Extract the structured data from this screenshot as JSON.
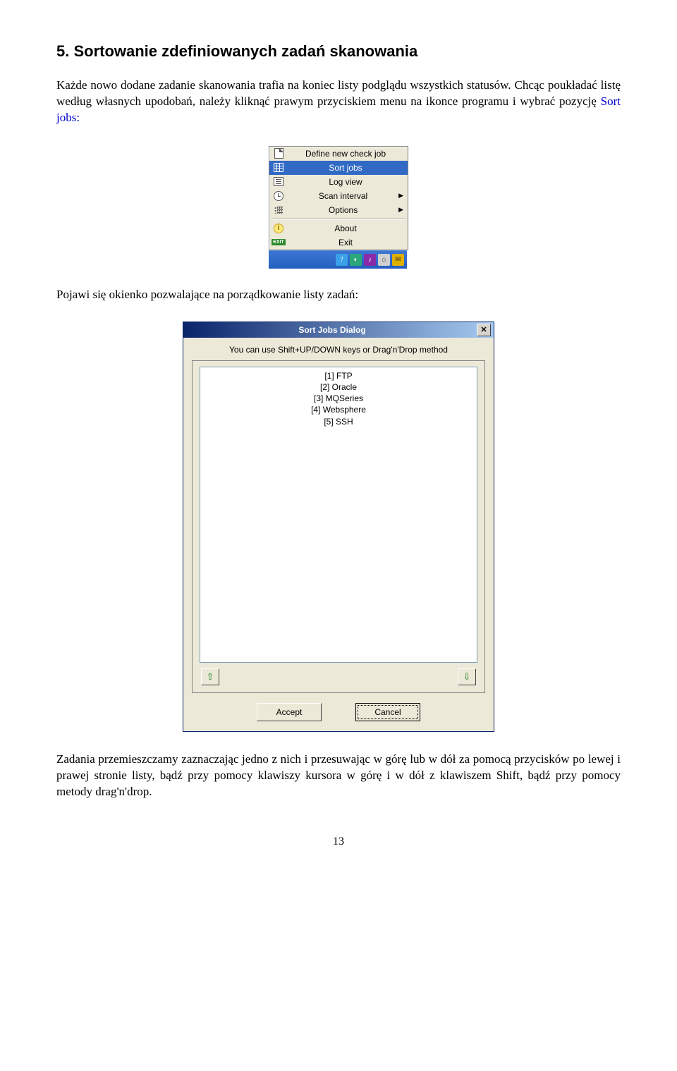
{
  "heading": "5. Sortowanie zdefiniowanych zadań skanowania",
  "para1": "Każde nowo dodane zadanie skanowania trafia na koniec listy podglądu wszystkich statusów. Chcąc poukładać listę według własnych upodobań, należy kliknąć prawym przyciskiem menu na ikonce programu i wybrać pozycję ",
  "para1_link": "Sort jobs:",
  "ctx_menu": {
    "items": [
      {
        "label": "Define new check job",
        "icon": "doc"
      },
      {
        "label": "Sort jobs",
        "icon": "grid",
        "selected": true
      },
      {
        "label": "Log view",
        "icon": "lines"
      },
      {
        "label": "Scan interval",
        "icon": "clock",
        "submenu": true
      },
      {
        "label": "Options",
        "icon": "list",
        "submenu": true
      },
      {
        "label": "About",
        "icon": "about",
        "sep_before": true
      },
      {
        "label": "Exit",
        "icon": "exit"
      }
    ]
  },
  "para2": "Pojawi się okienko pozwalające na porządkowanie listy zadań:",
  "dialog": {
    "title": "Sort Jobs Dialog",
    "hint": "You can use Shift+UP/DOWN keys or Drag'n'Drop method",
    "items": [
      "[1] FTP",
      "[2] Oracle",
      "[3] MQSeries",
      "[4] Websphere",
      "[5] SSH"
    ],
    "btn_up": "⇧",
    "btn_down": "⇩",
    "btn_accept": "Accept",
    "btn_cancel": "Cancel"
  },
  "para3": "Zadania przemieszczamy zaznaczając jedno z nich i przesuwając w górę lub w dół za pomocą przycisków po lewej i prawej stronie listy, bądź przy pomocy klawiszy kursora w górę i w dół z klawiszem Shift, bądź przy pomocy metody drag'n'drop.",
  "page_number": "13"
}
